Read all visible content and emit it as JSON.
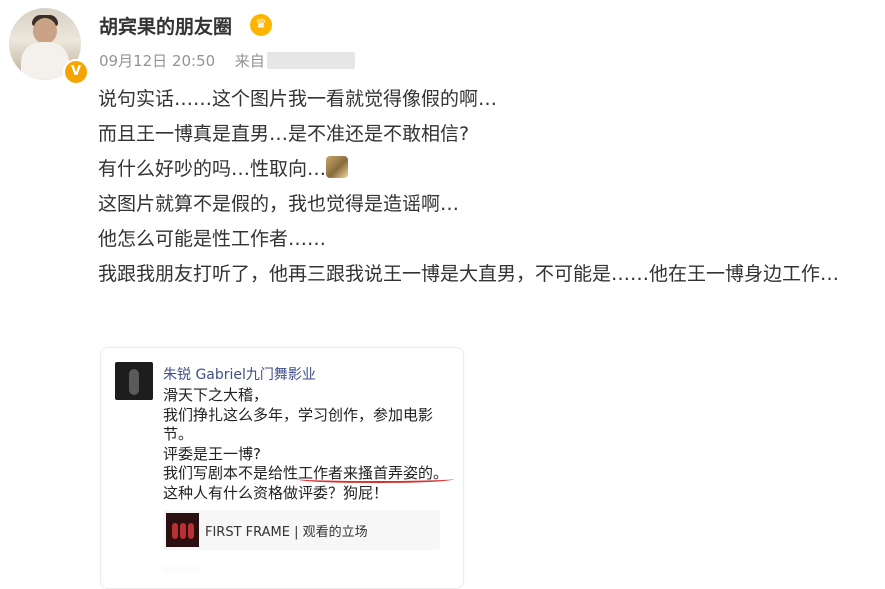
{
  "post": {
    "username": "胡宾果的朋友圈",
    "timestamp": "09月12日 20:50",
    "source_prefix": "来自",
    "lines": [
      "说句实话……这个图片我一看就觉得像假的啊…",
      "而且王一博真是直男…是不准还是不敢相信?",
      "有什么好吵的吗…性取向…",
      "这图片就算不是假的，我也觉得是造谣啊…",
      "他怎么可能是性工作者……",
      "我跟我朋友打听了，他再三跟我说王一博是大直男，不可能是……他在王一博身边工作…"
    ]
  },
  "embedded": {
    "name": "朱锐 Gabriel九门舞影业",
    "lines": [
      "滑天下之大稽，",
      "我们挣扎这么多年，学习创作，参加电影节。",
      "评委是王一博?",
      "我们写剧本不是给性工作者来搔首弄姿的。这种人有什么资格做评委？狗屁！"
    ],
    "link_title": "FIRST FRAME | 观看的立场"
  },
  "colors": {
    "badge": "#f5a500",
    "meta_gray": "#939393",
    "embedded_name": "#3f4f8a",
    "underline": "#d9302c"
  },
  "icons": {
    "verified": "verified-badge-icon",
    "member": "member-crown-icon",
    "emoji": "blurred-emoji-icon",
    "thumbnail": "video-thumbnail-icon"
  }
}
